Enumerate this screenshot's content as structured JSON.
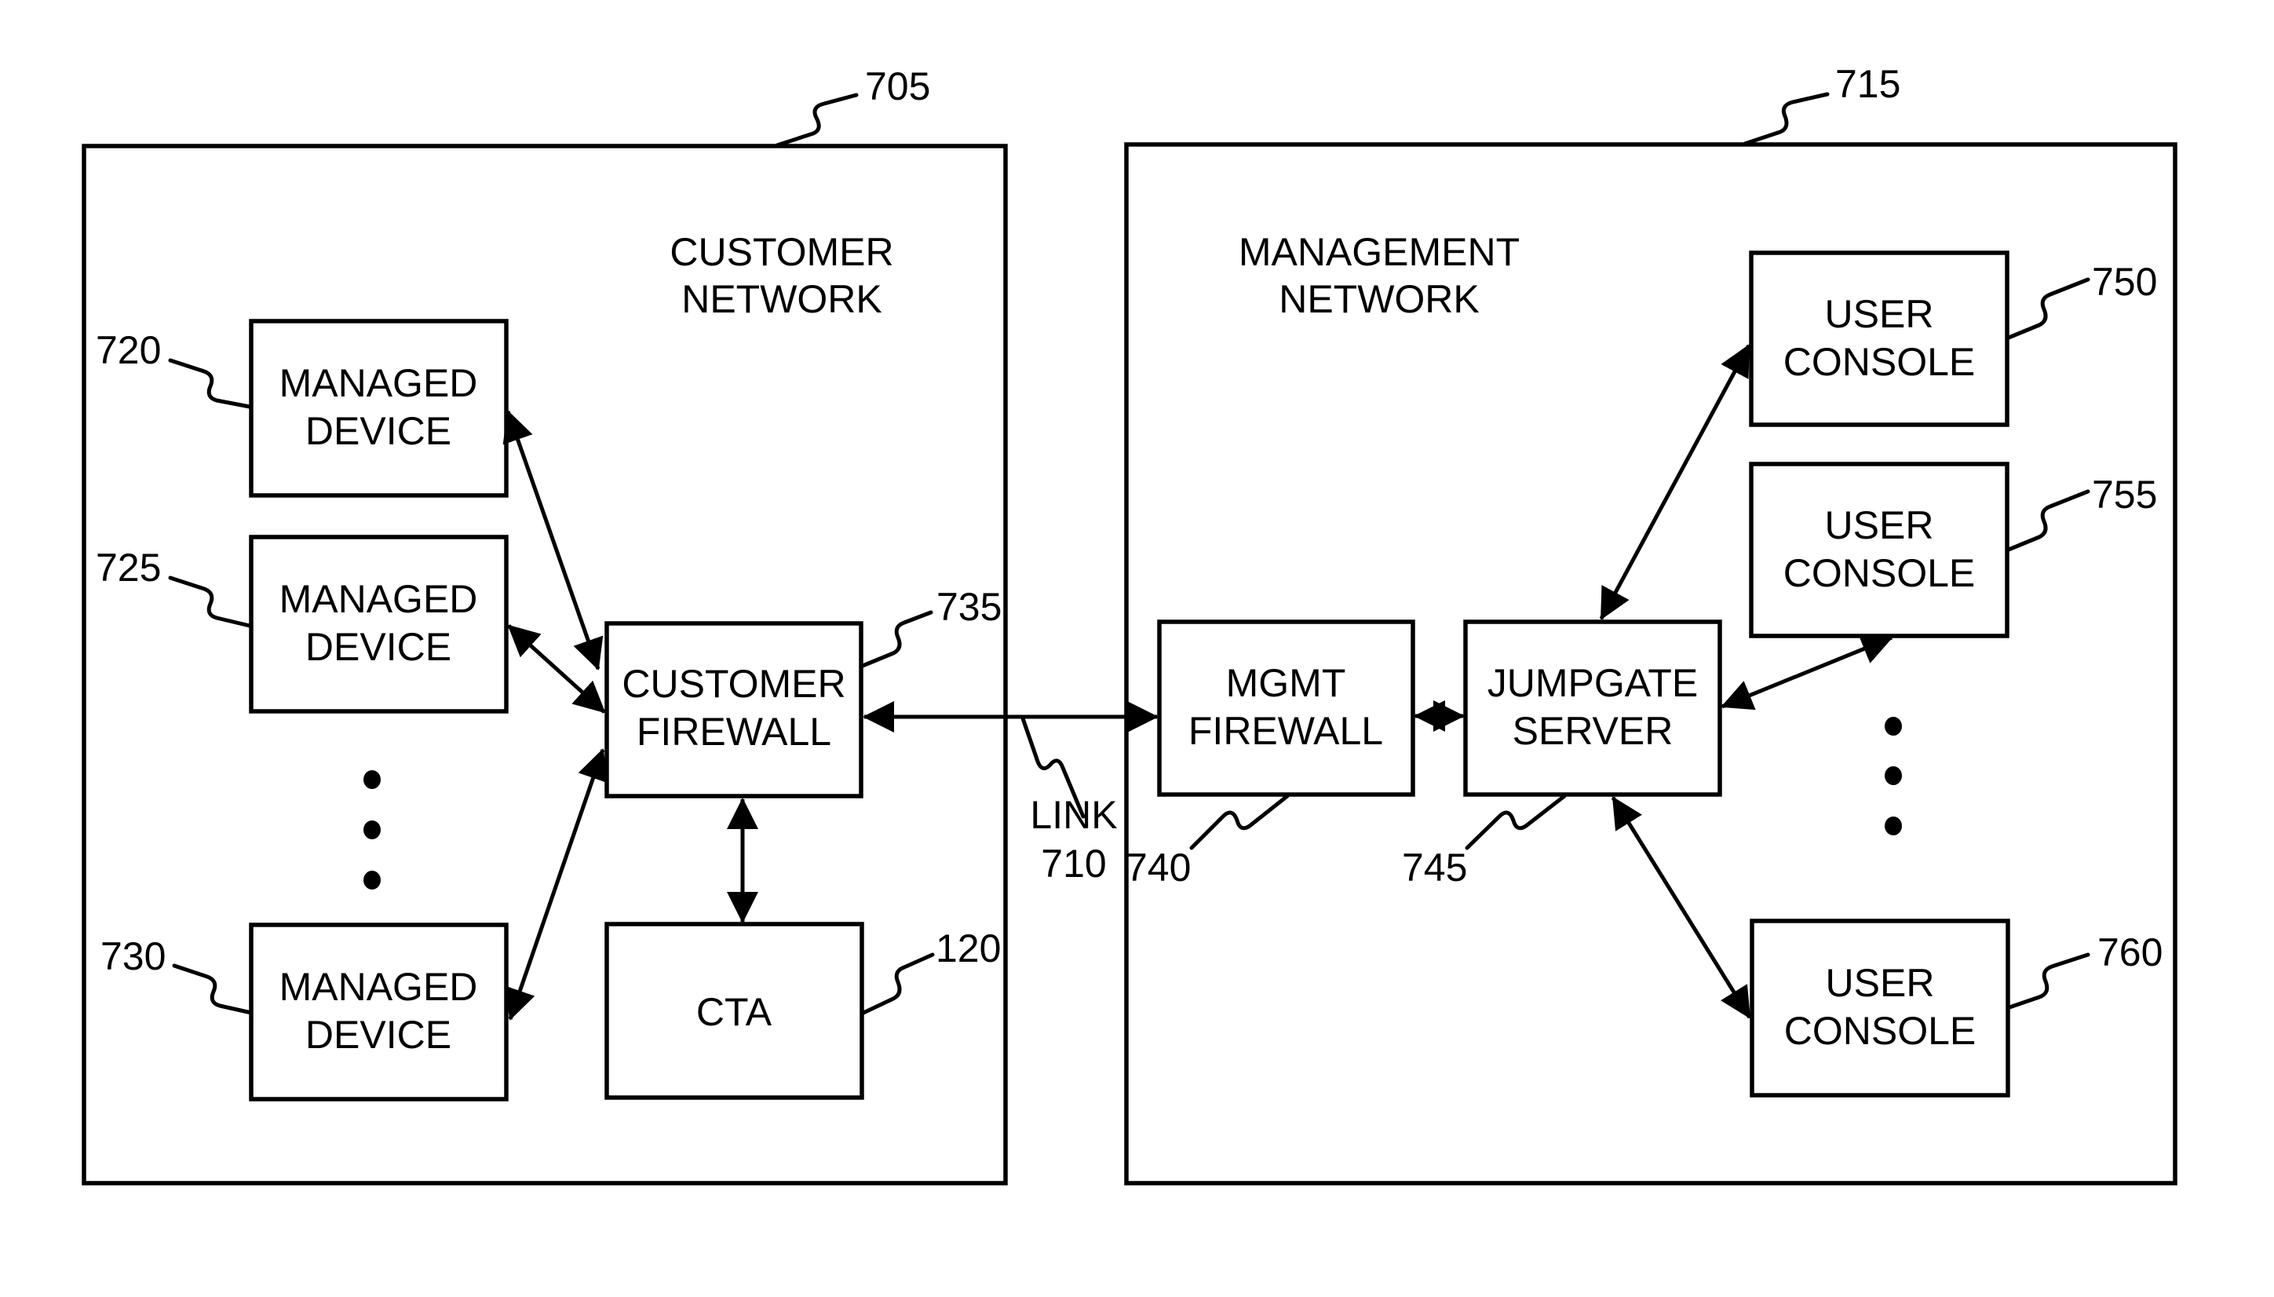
{
  "figure": {
    "customer_network": {
      "ref": "705",
      "title_lines": [
        "CUSTOMER",
        "NETWORK"
      ],
      "managed_devices": [
        {
          "ref": "720",
          "lines": [
            "MANAGED",
            "DEVICE"
          ]
        },
        {
          "ref": "725",
          "lines": [
            "MANAGED",
            "DEVICE"
          ]
        },
        {
          "ref": "730",
          "lines": [
            "MANAGED",
            "DEVICE"
          ]
        }
      ],
      "customer_firewall": {
        "ref": "735",
        "lines": [
          "CUSTOMER",
          "FIREWALL"
        ]
      },
      "cta": {
        "ref": "120",
        "lines": [
          "CTA"
        ]
      }
    },
    "link": {
      "lines": [
        "LINK",
        "710"
      ]
    },
    "management_network": {
      "ref": "715",
      "title_lines": [
        "MANAGEMENT",
        "NETWORK"
      ],
      "mgmt_firewall": {
        "ref": "740",
        "lines": [
          "MGMT",
          "FIREWALL"
        ]
      },
      "jumpgate_server": {
        "ref": "745",
        "lines": [
          "JUMPGATE",
          "SERVER"
        ]
      },
      "user_consoles": [
        {
          "ref": "750",
          "lines": [
            "USER",
            "CONSOLE"
          ]
        },
        {
          "ref": "755",
          "lines": [
            "USER",
            "CONSOLE"
          ]
        },
        {
          "ref": "760",
          "lines": [
            "USER",
            "CONSOLE"
          ]
        }
      ]
    },
    "colors": {
      "ink": "#000000",
      "paper": "#ffffff"
    }
  }
}
